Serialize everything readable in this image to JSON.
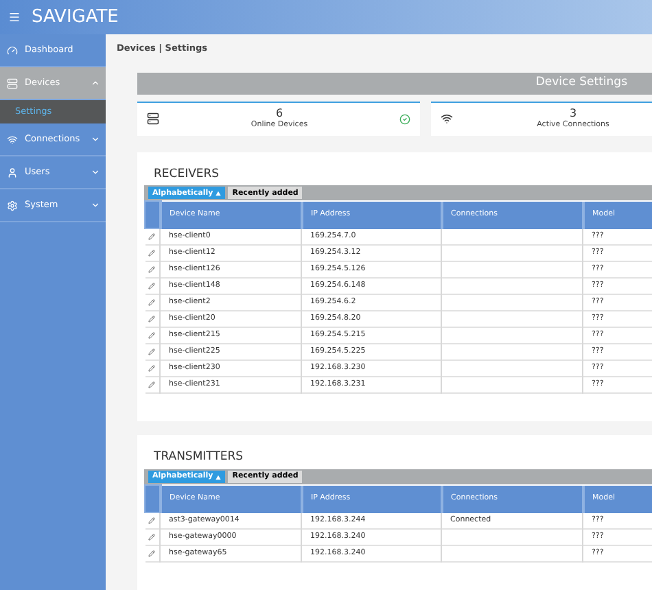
{
  "app": {
    "title": "SAVIGATE"
  },
  "sidebar": {
    "items": [
      {
        "label": "Dashboard",
        "selected": false
      },
      {
        "label": "Devices",
        "selected": true,
        "expanded": true,
        "children": [
          {
            "label": "Settings",
            "selected": true
          }
        ]
      },
      {
        "label": "Connections",
        "selected": false,
        "expanded": false
      },
      {
        "label": "Users",
        "selected": false,
        "expanded": false
      },
      {
        "label": "System",
        "selected": false,
        "expanded": false
      }
    ]
  },
  "breadcrumb": "Devices | Settings",
  "banner": {
    "title": "Device Settings"
  },
  "stats": [
    {
      "value": "6",
      "label": "Online Devices",
      "ok": true
    },
    {
      "value": "3",
      "label": "Active Connections"
    }
  ],
  "sections": [
    {
      "title": "RECEIVERS",
      "sort_tabs": [
        {
          "label": "Alphabetically",
          "selected": true
        },
        {
          "label": "Recently added",
          "selected": false
        }
      ],
      "columns": [
        "Device Name",
        "IP Address",
        "Connections",
        "Model"
      ],
      "rows": [
        [
          "hse-client0",
          "169.254.7.0",
          "",
          "???"
        ],
        [
          "hse-client12",
          "169.254.3.12",
          "",
          "???"
        ],
        [
          "hse-client126",
          "169.254.5.126",
          "",
          "???"
        ],
        [
          "hse-client148",
          "169.254.6.148",
          "",
          "???"
        ],
        [
          "hse-client2",
          "169.254.6.2",
          "",
          "???"
        ],
        [
          "hse-client20",
          "169.254.8.20",
          "",
          "???"
        ],
        [
          "hse-client215",
          "169.254.5.215",
          "",
          "???"
        ],
        [
          "hse-client225",
          "169.254.5.225",
          "",
          "???"
        ],
        [
          "hse-client230",
          "192.168.3.230",
          "",
          "???"
        ],
        [
          "hse-client231",
          "192.168.3.231",
          "",
          "???"
        ]
      ]
    },
    {
      "title": "TRANSMITTERS",
      "sort_tabs": [
        {
          "label": "Alphabetically",
          "selected": true
        },
        {
          "label": "Recently added",
          "selected": false
        }
      ],
      "columns": [
        "Device Name",
        "IP Address",
        "Connections",
        "Model"
      ],
      "rows": [
        [
          "ast3-gateway0014",
          "192.168.3.244",
          "Connected",
          "???"
        ],
        [
          "hse-gateway0000",
          "192.168.3.240",
          "",
          "???"
        ],
        [
          "hse-gateway65",
          "192.168.3.240",
          "",
          "???"
        ]
      ]
    }
  ]
}
